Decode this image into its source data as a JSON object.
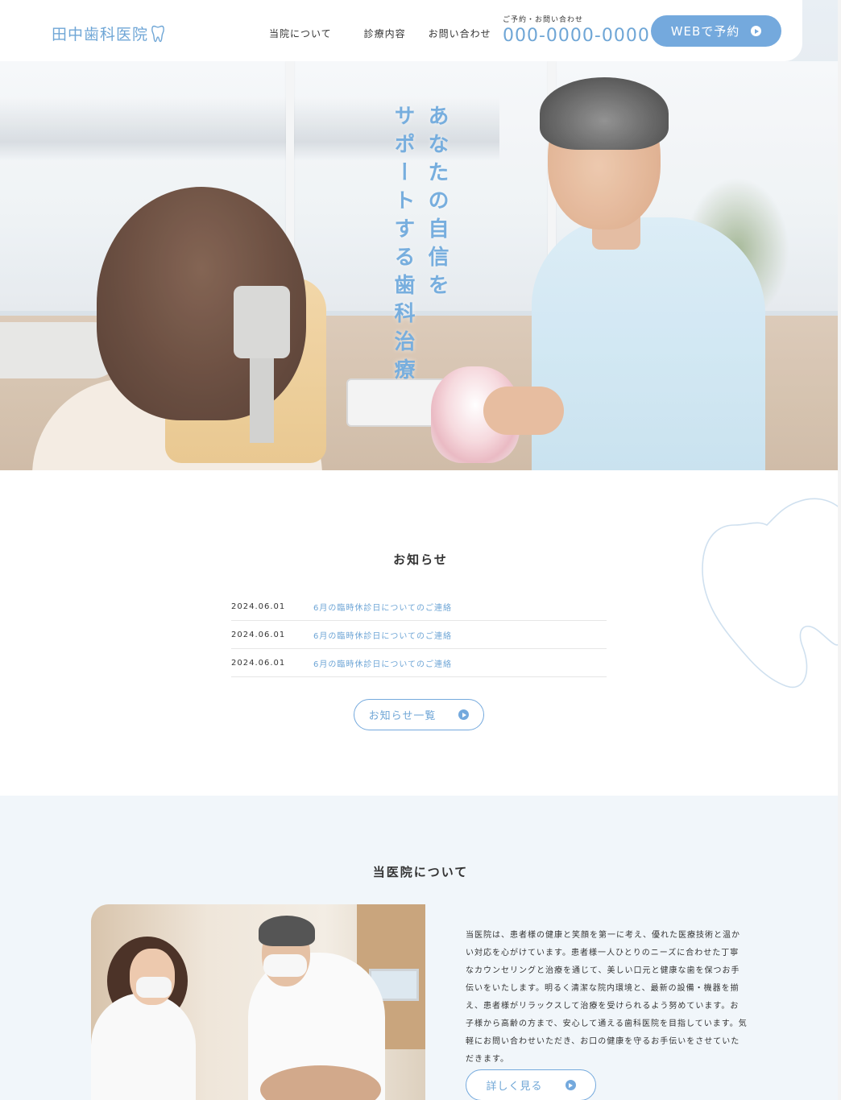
{
  "header": {
    "logo_text": "田中歯科医院",
    "nav": [
      {
        "label": "当院について"
      },
      {
        "label": "診療内容"
      },
      {
        "label": "お問い合わせ"
      }
    ],
    "tel_label": "ご予約・お問い合わせ",
    "tel_number": "000-0000-0000",
    "web_button_label": "WEBで予約"
  },
  "hero": {
    "catch_line1": "あなたの自信を",
    "catch_line2": "サポートする歯科治療"
  },
  "news": {
    "title": "お知らせ",
    "items": [
      {
        "date": "2024.06.01",
        "text": "6月の臨時休診日についてのご連絡"
      },
      {
        "date": "2024.06.01",
        "text": "6月の臨時休診日についてのご連絡"
      },
      {
        "date": "2024.06.01",
        "text": "6月の臨時休診日についてのご連絡"
      }
    ],
    "button_label": "お知らせ一覧"
  },
  "about": {
    "title": "当医院について",
    "body": "当医院は、患者様の健康と笑顔を第一に考え、優れた医療技術と温かい対応を心がけています。患者様一人ひとりのニーズに合わせた丁寧なカウンセリングと治療を通じて、美しい口元と健康な歯を保つお手伝いをいたします。明るく清潔な院内環境と、最新の設備・機器を揃え、患者様がリラックスして治療を受けられるよう努めています。お子様から高齢の方まで、安心して通える歯科医院を目指しています。気軽にお問い合わせいただき、お口の健康を守るお手伝いをさせていただきます。",
    "button_label": "詳しく見る"
  },
  "colors": {
    "accent": "#74a9dd",
    "accent_text": "#6fa6d6",
    "section_bg": "#f1f6fa"
  },
  "icons": {
    "logo": "tooth-icon",
    "button_arrow": "circle-arrow-right-icon",
    "background_shape": "tooth-outline-icon"
  }
}
